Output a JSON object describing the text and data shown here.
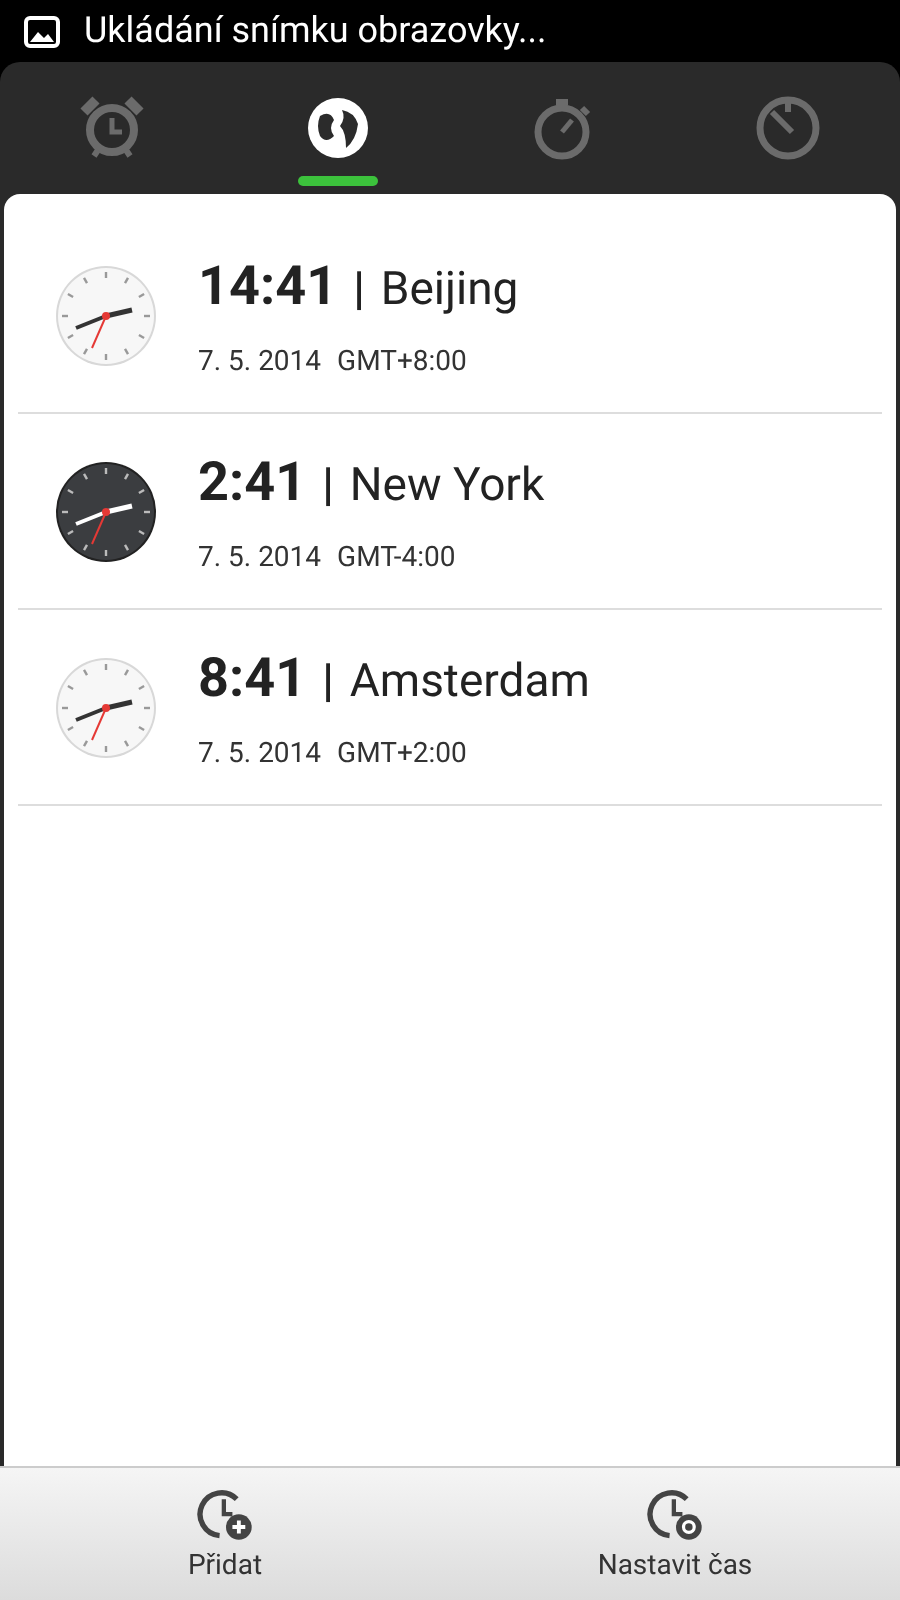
{
  "status_bar": {
    "notification": "Ukládání snímku obrazovky..."
  },
  "tabs": [
    {
      "kind": "alarm",
      "selected": false
    },
    {
      "kind": "world",
      "selected": true
    },
    {
      "kind": "stopwatch",
      "selected": false
    },
    {
      "kind": "timer",
      "selected": false
    }
  ],
  "clocks": [
    {
      "time": "14:41",
      "separator": "|",
      "city": "Beijing",
      "date": "7. 5. 2014",
      "offset": "GMT+8:00",
      "night": false
    },
    {
      "time": "2:41",
      "separator": "|",
      "city": "New York",
      "date": "7. 5. 2014",
      "offset": "GMT-4:00",
      "night": true
    },
    {
      "time": "8:41",
      "separator": "|",
      "city": "Amsterdam",
      "date": "7. 5. 2014",
      "offset": "GMT+2:00",
      "night": false
    }
  ],
  "bottom_bar": [
    {
      "kind": "add",
      "label": "Přidat"
    },
    {
      "kind": "set",
      "label": "Nastavit čas"
    }
  ]
}
